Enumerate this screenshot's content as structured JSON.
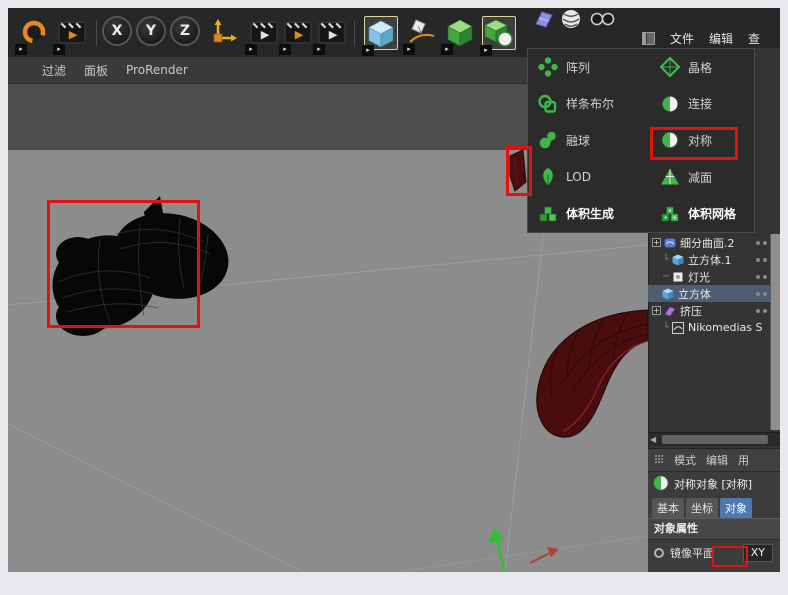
{
  "colors": {
    "annotation_red": "#e11212",
    "selection_blue": "#4f78b0",
    "menu_green": "#3fb54a",
    "viewport_ground": "#8c8c8c",
    "viewport_sky": "#4e4e4e"
  },
  "toolbar": {
    "x_button": "X",
    "y_button": "Y",
    "z_button": "Z",
    "icons": [
      "undo-arc-icon",
      "clapper-icon",
      "x-axis-lock",
      "y-axis-lock",
      "z-axis-lock",
      "coordinate-system-icon",
      "clapper-icon",
      "clapper-icon",
      "clapper-icon",
      "cube-primitive-icon",
      "spline-pen-icon",
      "generator-cube-icon",
      "generator-cube-sphere-icon",
      "plane-icon",
      "striped-sphere-icon",
      "render-view-icon"
    ]
  },
  "top_menu": {
    "items": [
      "文件",
      "编辑",
      "查"
    ]
  },
  "filter_bar": {
    "items": [
      "过滤",
      "面板",
      "ProRender"
    ]
  },
  "generator_menu": {
    "left_items": [
      {
        "label": "阵列",
        "icon": "array-icon"
      },
      {
        "label": "样条布尔",
        "icon": "spline-boolean-icon"
      },
      {
        "label": "融球",
        "icon": "metaball-icon"
      },
      {
        "label": "LOD",
        "icon": "lod-icon"
      },
      {
        "label": "体积生成",
        "icon": "volume-builder-icon"
      }
    ],
    "right_items": [
      {
        "label": "晶格",
        "icon": "lattice-icon"
      },
      {
        "label": "连接",
        "icon": "connect-icon"
      },
      {
        "label": "对称",
        "icon": "symmetry-icon"
      },
      {
        "label": "减面",
        "icon": "polygon-reduction-icon"
      },
      {
        "label": "体积网格",
        "icon": "volume-mesher-icon"
      }
    ]
  },
  "object_manager": {
    "rows": [
      {
        "label": "细分曲面.2",
        "icon": "subdivision-surface-icon",
        "depth": 0,
        "expandable": true
      },
      {
        "label": "立方体.1",
        "icon": "cube-icon",
        "depth": 1
      },
      {
        "label": "灯光",
        "icon": "light-icon",
        "depth": 1
      },
      {
        "label": "立方体",
        "icon": "cube-icon",
        "depth": 0,
        "selected": true
      },
      {
        "label": "挤压",
        "icon": "extrude-icon",
        "depth": 0,
        "expandable": true
      },
      {
        "label": "Nikomedias S",
        "icon": "spline-icon",
        "depth": 1
      }
    ]
  },
  "attribute_panel": {
    "menu_items": [
      "模式",
      "编辑",
      "用"
    ],
    "object_title": "对称对象 [对称]",
    "object_icon": "symmetry-icon",
    "tabs": [
      "基本",
      "坐标",
      "对象"
    ],
    "active_tab": "对象",
    "section_title": "对象属性",
    "mirror_plane_label": "镜像平面",
    "mirror_plane_value": "XY"
  },
  "viewport_objects": [
    "wireframe-mesh-object",
    "red-object-fragment",
    "red-tube-object",
    "axis-arrow-green",
    "axis-arrow-red",
    "grid-lines"
  ]
}
